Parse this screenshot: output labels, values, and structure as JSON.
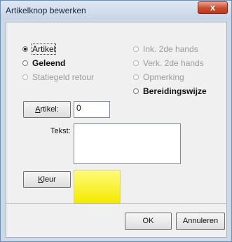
{
  "window": {
    "title": "Artikelknop bewerken",
    "close_symbol": "x"
  },
  "radios": {
    "artikel": {
      "label": "Artikel",
      "selected": true,
      "enabled": true
    },
    "geleend": {
      "label": "Geleend",
      "selected": false,
      "enabled": true
    },
    "statiegeld": {
      "label": "Statiegeld retour",
      "selected": false,
      "enabled": false
    },
    "ink2": {
      "label": "Ink. 2de hands",
      "selected": false,
      "enabled": false
    },
    "verk2": {
      "label": "Verk. 2de hands",
      "selected": false,
      "enabled": false
    },
    "opmerking": {
      "label": "Opmerking",
      "selected": false,
      "enabled": false
    },
    "bereiding": {
      "label": "Bereidingswijze",
      "selected": false,
      "enabled": true
    }
  },
  "artikel_button": {
    "label": "Artikel:",
    "mnemonic": "A"
  },
  "artikel_value": "0",
  "tekst_label": "Tekst:",
  "tekst_value": "",
  "kleur_button": {
    "label": "Kleur",
    "mnemonic": "K"
  },
  "kleur_color": "#fff33b",
  "footer": {
    "ok_label": "OK",
    "cancel_label": "Annuleren"
  }
}
